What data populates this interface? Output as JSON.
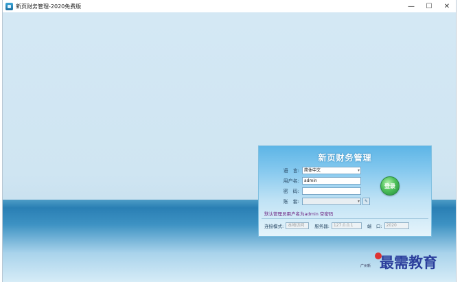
{
  "window": {
    "title": "新页财务管理-2020免费版",
    "minimize": "—",
    "maximize": "☐",
    "close": "✕"
  },
  "login": {
    "title": "新页财务管理",
    "language_label": "语　言:",
    "language_value": "简体中文",
    "username_label": "用户名:",
    "username_value": "admin",
    "password_label": "密　码:",
    "password_value": "",
    "account_label": "账　套:",
    "account_value": "",
    "login_button": "登录",
    "hint": "默认管理员用户名为admin 空密码",
    "mode_label": "连接模式:",
    "mode_value": "本地访问",
    "server_label": "服务器:",
    "server_value": "127.0.0.1",
    "port_label": "端　口:",
    "port_value": "2020"
  },
  "footer_text": "广州新",
  "watermark": "最需教育",
  "icons": [
    "app-icon",
    "minimize-icon",
    "maximize-icon",
    "close-icon",
    "dropdown-icon",
    "settings-icon"
  ],
  "colors": {
    "panel_top": "#5db5e6",
    "background": "#cfe5f2",
    "sea": "#2a7fb4",
    "hint": "#6a1c7c",
    "login_button": "#4fc15b"
  }
}
